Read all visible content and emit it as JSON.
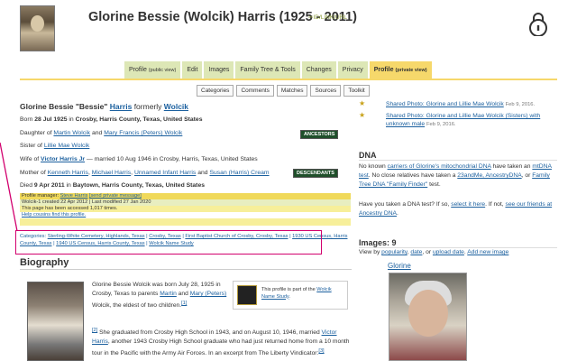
{
  "header": {
    "title": "Glorine Bessie (Wolcik) Harris (1925 - 2011)",
    "wikitree_id": "ID/LINK/URL"
  },
  "tabs": [
    {
      "label": "Profile",
      "sub": "(public view)"
    },
    {
      "label": "Edit"
    },
    {
      "label": "Images"
    },
    {
      "label": "Family Tree & Tools"
    },
    {
      "label": "Changes"
    },
    {
      "label": "Privacy"
    },
    {
      "label": "Profile",
      "sub": "(private view)"
    }
  ],
  "subtabs": [
    "Categories",
    "Comments",
    "Matches",
    "Sources",
    "Toolkit"
  ],
  "person": {
    "name_quoted": "Glorine Bessie \"Bessie\"",
    "surname_married": "Harris",
    "formerly": "formerly",
    "surname_birth": "Wolcik",
    "born_label": "Born",
    "born_date": "28 Jul 1925",
    "born_in": "in",
    "born_place": "Crosby, Harris County, Texas, United States",
    "daughter_label": "Daughter of",
    "father": "Martin Wolcik",
    "and": "and",
    "mother": "Mary Francis (Peters) Wolcik",
    "sister_label": "Sister of",
    "sibling": "Lillie Mae Wolcik",
    "wife_label": "Wife of",
    "husband": "Victor Harris Jr",
    "married_text": "— married 10 Aug 1946 in Crosby, Harris, Texas, United States",
    "mother_label": "Mother of",
    "child1": "Kenneth Harris",
    "child2": "Michael Harris",
    "child3": "Unnamed Infant Harris",
    "child4": "Susan (Harris) Cream",
    "died_label": "Died",
    "died_date": "9 Apr 2011",
    "died_in": "in",
    "died_place": "Baytown, Harris County, Texas, United States",
    "ancestors_badge": "ANCESTORS",
    "descendants_badge": "DESCENDANTS"
  },
  "manager_box": {
    "manager_label": "Profile manager:",
    "manager_name": "Steve Harris",
    "send_message": "[send private message]",
    "created": "Wolcik-1 created 22 Apr 2012 | Last modified 27 Jan 2020",
    "accessed": "This page has been accessed 1,017 times.",
    "help": "Help cousins find this profile."
  },
  "categories": {
    "label": "Categories:",
    "items": [
      "Sterling-White Cemetery, Highlands, Texas",
      "Crosby, Texas",
      "First Baptist Church of Crosby, Crosby, Texas",
      "1930 US Census, Harris County, Texas",
      "1940 US Census, Harris County, Texas",
      "Wolcik Name Study"
    ]
  },
  "biography": {
    "heading": "Biography",
    "para1_a": "Glorine Bessie Wolcik was born July 28, 1925 in Crosby, Texas to parents",
    "para1_martin": "Martin",
    "para1_and": "and",
    "para1_mary": "Mary (Peters)",
    "para1_b": "Wolcik, the eldest of two children.",
    "fn1": "[1]",
    "fn2": "[2]",
    "para2_a": "She graduated from Crosby High School in 1943, and on August 10, 1946, married",
    "para2_victor": "Victor Harris",
    "para2_b": ", another 1943 Crosby High School graduate who had just returned home from a 10 month tour in the Pacific with the Army Air Forces. In an excerpt from The Liberty Vindicator:",
    "fn3": "[3]",
    "study_text": "This profile is part of the",
    "study_link": "Wolcik Name Study",
    "study_end": "."
  },
  "feed": [
    {
      "text": "Shared Photo: Glorine and Lillie Mae Wolcik",
      "date": "Feb 9, 2016."
    },
    {
      "text": "Shared Photo: Glorine and Lillie Mae Wolcik (Sisters) with unknown male",
      "date": "Feb 9, 2016."
    }
  ],
  "dna": {
    "heading": "DNA",
    "p1_a": "No known",
    "p1_link": "carriers of Glorine's mitochondrial DNA",
    "p1_b": "have taken an",
    "p1_link2": "mtDNA test",
    "p1_c": ". No close relatives have taken a",
    "p1_link3": "23andMe, AncestryDNA",
    "p1_d": ", or",
    "p1_link4": "Family Tree DNA \"Family Finder\"",
    "p1_e": "test.",
    "p2_a": "Have you taken a DNA test? If so,",
    "p2_link": "select it here",
    "p2_b": ". If not,",
    "p2_link2": "see our friends at Ancestry DNA",
    "p2_c": "."
  },
  "images": {
    "heading": "Images: 9",
    "view_by": "View by",
    "popularity": "popularity",
    "date": "date",
    "or": ", or",
    "upload_date": "upload date",
    "add": "Add new image",
    "caption": "Glorine"
  }
}
